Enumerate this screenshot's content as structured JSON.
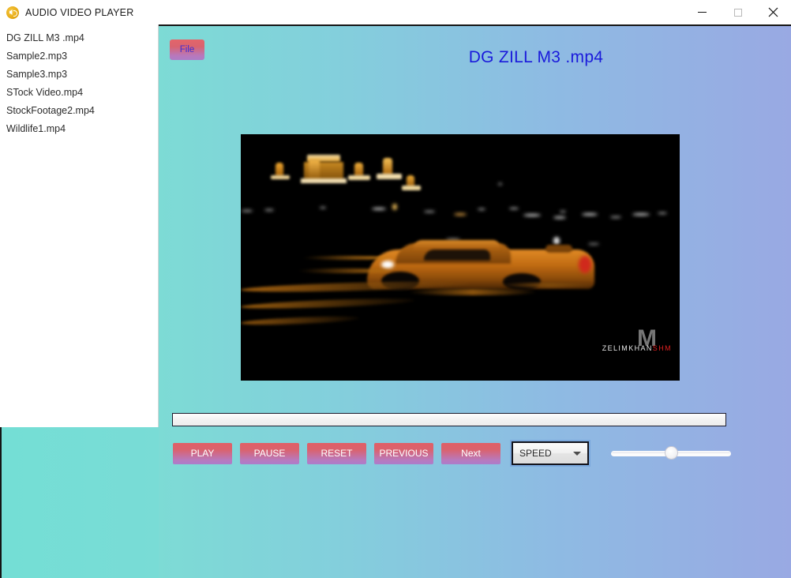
{
  "window": {
    "title": "AUDIO VIDEO PLAYER",
    "app_icon": "speaker-icon",
    "minimize_label": "–",
    "maximize_label": "□",
    "close_label": "✕"
  },
  "sidebar": {
    "files": [
      "DG ZILL M3 .mp4",
      "Sample2.mp3",
      "Sample3.mp3",
      "STock Video.mp4",
      "StockFootage2.mp4",
      "Wildlife1.mp4"
    ]
  },
  "main": {
    "file_button_label": "File",
    "now_playing": "DG ZILL M3 .mp4"
  },
  "video": {
    "watermark_mark": "M",
    "watermark_name": "ZELIMKHAN",
    "watermark_suffix": "SHM",
    "scene": "night car motion blur"
  },
  "controls": {
    "buttons": [
      {
        "label": "PLAY",
        "name": "play-button"
      },
      {
        "label": "PAUSE",
        "name": "pause-button"
      },
      {
        "label": "RESET",
        "name": "reset-button"
      },
      {
        "label": "PREVIOUS",
        "name": "previous-button"
      },
      {
        "label": "Next",
        "name": "next-button"
      }
    ],
    "speed_label": "SPEED",
    "speed_options": [
      "SPEED"
    ],
    "progress_value": 0,
    "volume_value": 50
  },
  "colors": {
    "accent_button_start": "#e05f66",
    "accent_button_end": "#ac7dcb",
    "panel_gradient_start": "#7ddbd5",
    "panel_gradient_end": "#99a9e3",
    "title_text": "#1a1adb",
    "file_button_text": "#3b2bd6",
    "watermark_suffix": "#e02020"
  }
}
